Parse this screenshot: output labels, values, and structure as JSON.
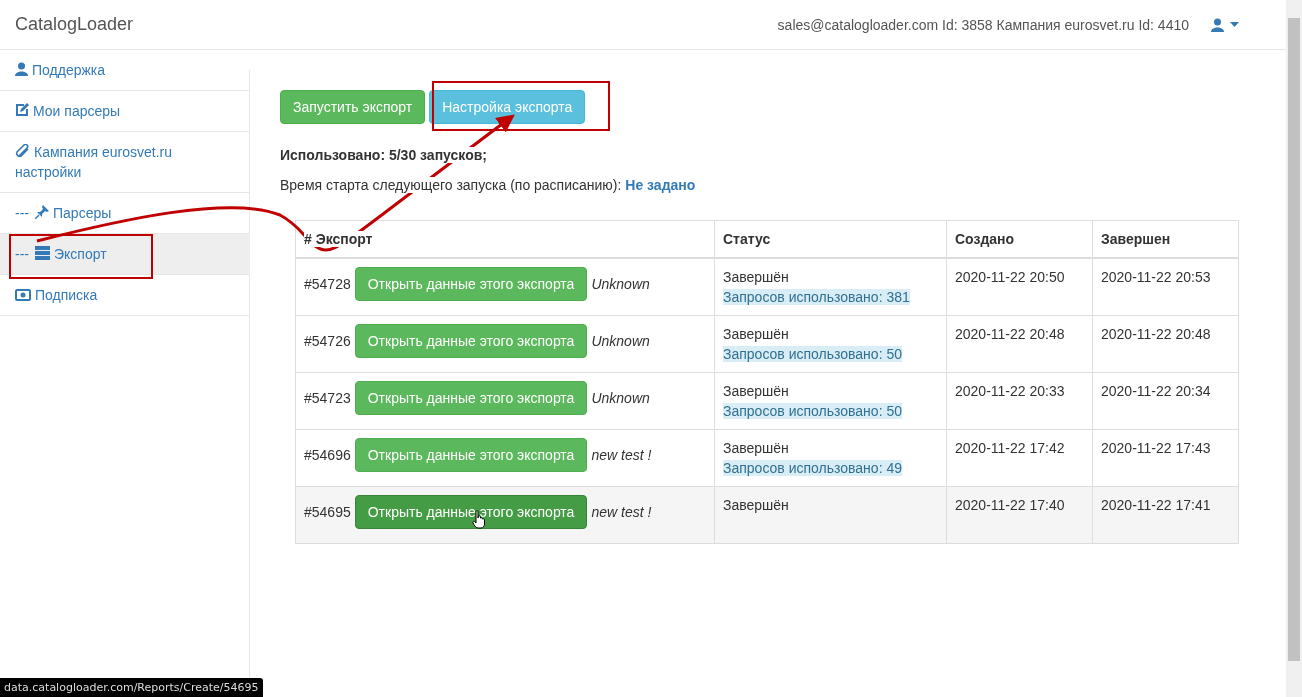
{
  "navbar": {
    "brand": "CatalogLoader",
    "account": "sales@catalogloader.com Id: 3858 Кампания eurosvet.ru Id: 4410"
  },
  "sidebar": {
    "items": [
      {
        "label": "Поддержка",
        "selected": false
      },
      {
        "label": "Мои парсеры",
        "selected": false
      },
      {
        "label": "Кампания eurosvet.ru настройки",
        "selected": false
      },
      {
        "label": "Парсеры",
        "prefix": "---",
        "selected": false
      },
      {
        "label": "Экспорт",
        "prefix": "---",
        "selected": true
      },
      {
        "label": "Подписка",
        "selected": false
      }
    ]
  },
  "actions": [
    {
      "label": "Запустить экспорт",
      "kind": "success"
    },
    {
      "label": "Настройка экспорта",
      "kind": "info"
    }
  ],
  "usage": "Использовано: 5/30 запусков;",
  "schedule": {
    "label": "Время старта следующего запуска (по расписанию):",
    "value": "Не задано"
  },
  "table": {
    "columns": [
      "# Экспорт",
      "Статус",
      "Создано",
      "Завершен"
    ],
    "rows": [
      {
        "id": "#54728",
        "button": "Открыть данные этого экспорта",
        "name": "Unknown",
        "status": "Завершён",
        "requests": "Запросов использовано: 381",
        "created": "2020-11-22 20:50",
        "finished": "2020-11-22 20:53",
        "hovered": false
      },
      {
        "id": "#54726",
        "button": "Открыть данные этого экспорта",
        "name": "Unknown",
        "status": "Завершён",
        "requests": "Запросов использовано: 50",
        "created": "2020-11-22 20:48",
        "finished": "2020-11-22 20:48",
        "hovered": false
      },
      {
        "id": "#54723",
        "button": "Открыть данные этого экспорта",
        "name": "Unknown",
        "status": "Завершён",
        "requests": "Запросов использовано: 50",
        "created": "2020-11-22 20:33",
        "finished": "2020-11-22 20:34",
        "hovered": false
      },
      {
        "id": "#54696",
        "button": "Открыть данные этого экспорта",
        "name": "new test !",
        "status": "Завершён",
        "requests": "Запросов использовано: 49",
        "created": "2020-11-22 17:42",
        "finished": "2020-11-22 17:43",
        "hovered": false
      },
      {
        "id": "#54695",
        "button": "Открыть данные этого экспорта",
        "name": "new test !",
        "status": "Завершён",
        "created": "2020-11-22 17:40",
        "finished": "2020-11-22 17:41",
        "hovered": true
      }
    ]
  },
  "status_url": "data.catalogloader.com/Reports/Create/54695"
}
